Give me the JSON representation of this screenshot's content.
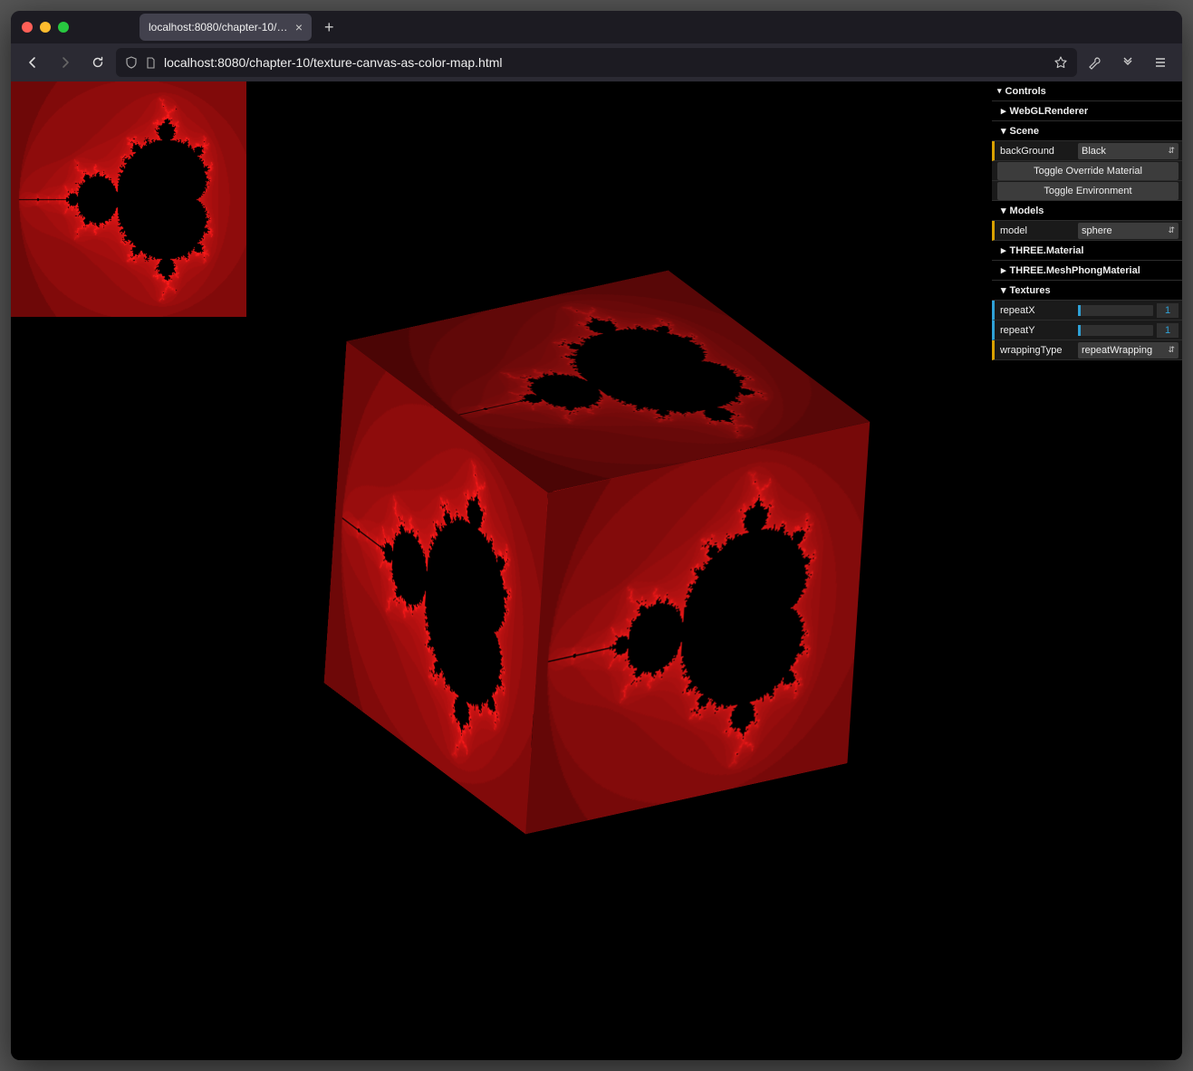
{
  "browser": {
    "tab_title": "localhost:8080/chapter-10/texture-c",
    "url": "localhost:8080/chapter-10/texture-canvas-as-color-map.html"
  },
  "gui": {
    "root_label": "Controls",
    "folders": {
      "webgl": "WebGLRenderer",
      "scene": "Scene",
      "models": "Models",
      "threemat": "THREE.Material",
      "phong": "THREE.MeshPhongMaterial",
      "textures": "Textures"
    },
    "scene": {
      "background_label": "backGround",
      "background_value": "Black",
      "toggle_override": "Toggle Override Material",
      "toggle_env": "Toggle Environment"
    },
    "models": {
      "model_label": "model",
      "model_value": "sphere"
    },
    "textures": {
      "repeatX_label": "repeatX",
      "repeatX_value": "1",
      "repeatY_label": "repeatY",
      "repeatY_value": "1",
      "wrapping_label": "wrappingType",
      "wrapping_value": "repeatWrapping"
    }
  }
}
